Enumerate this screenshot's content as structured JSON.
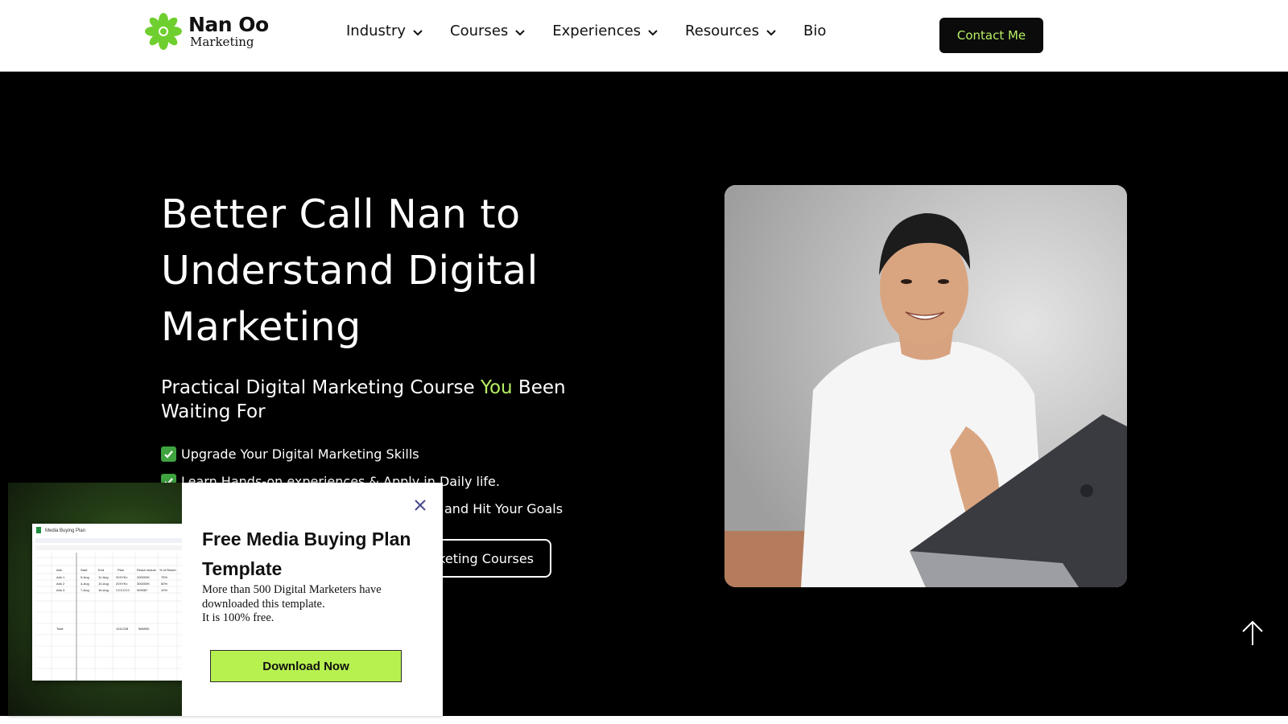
{
  "header": {
    "logo": {
      "name": "Nan Oo",
      "sub": "Marketing",
      "icon": "leaf-flower-icon",
      "color": "#6fcf2e"
    },
    "nav": [
      {
        "label": "Industry",
        "has_dropdown": true
      },
      {
        "label": "Courses",
        "has_dropdown": true
      },
      {
        "label": "Experiences",
        "has_dropdown": true
      },
      {
        "label": "Resources",
        "has_dropdown": true
      },
      {
        "label": "Bio",
        "has_dropdown": false
      }
    ],
    "contact_label": "Contact Me"
  },
  "hero": {
    "title": "Better Call Nan to Understand Digital Marketing",
    "subtitle_before": "Practical Digital Marketing Course ",
    "subtitle_accent": "You",
    "subtitle_after": " Been Waiting For",
    "bullets": [
      "Upgrade Your Digital Marketing Skills",
      "Learn Hands-on experiences & Apply in Daily life.",
      "and Hit Your Goals"
    ],
    "courses_button": "keting Courses",
    "photo": "portrait-photo"
  },
  "popup": {
    "title": "Free Media Buying Plan Template",
    "body_line1": "More than 500 Digital Marketers have downloaded this template.",
    "body_line2": "It is 100% free.",
    "button": "Download Now",
    "sheet": {
      "title": "Media Buying Plan",
      "headers": [
        "Ads",
        "Start",
        "End",
        "Plan",
        "Reach Actual",
        "% of Reach"
      ],
      "rows": [
        [
          "Ads 1",
          "5-Aug",
          "11-Aug",
          "20XYKc",
          "200000K",
          "75%"
        ],
        [
          "Ads 2",
          "4-Aug",
          "10-Aug",
          "20XYKc",
          "300000K",
          "60%"
        ],
        [
          "Ads 3",
          "7-Aug",
          "16-Aug",
          "CCCCCC",
          "909087",
          "10%"
        ]
      ],
      "total_label": "Total",
      "total_values": [
        "1011228",
        "586590"
      ]
    }
  },
  "colors": {
    "accent": "#b7ee63",
    "hero_bg": "#000000",
    "button_green": "#b7f150"
  },
  "icons": {
    "close": "close-icon",
    "scroll_top": "arrow-up-icon",
    "chevron": "chevron-down-icon",
    "check": "checkmark-icon"
  }
}
